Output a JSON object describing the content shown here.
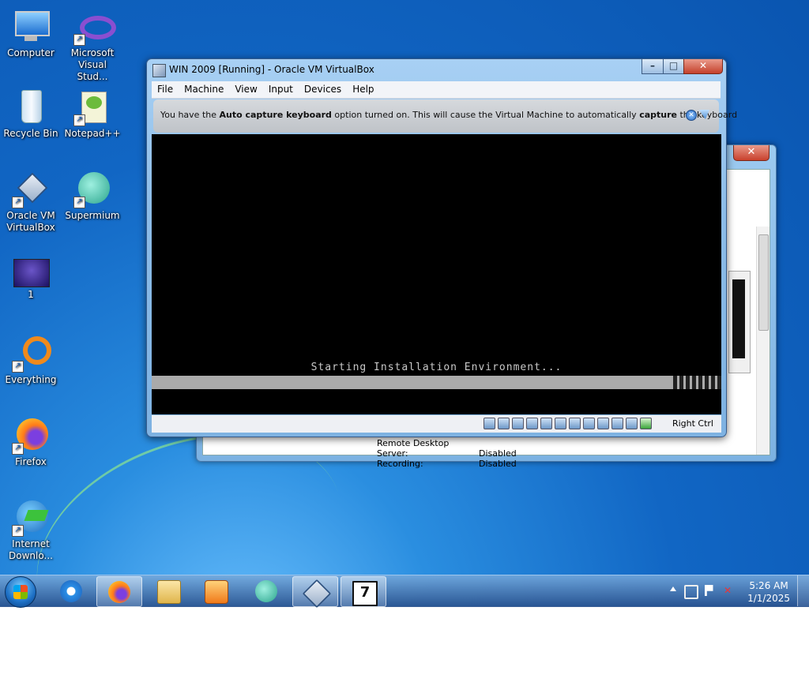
{
  "desktop": {
    "icons": [
      {
        "label": "Computer",
        "icon": "computer-icon"
      },
      {
        "label": "Microsoft Visual Stud...",
        "icon": "visual-studio-icon"
      },
      {
        "label": "Recycle Bin",
        "icon": "recycle-bin-icon"
      },
      {
        "label": "Notepad++",
        "icon": "notepad-plus-plus-icon"
      },
      {
        "label": "Oracle VM VirtualBox",
        "icon": "virtualbox-icon"
      },
      {
        "label": "Supermium",
        "icon": "supermium-icon"
      },
      {
        "label": "1",
        "icon": "image-file-icon"
      },
      {
        "label": "Everything",
        "icon": "everything-search-icon"
      },
      {
        "label": "Firefox",
        "icon": "firefox-icon"
      },
      {
        "label": "Internet Downlo...",
        "icon": "internet-download-manager-icon"
      }
    ]
  },
  "vbox_window": {
    "title": "WIN 2009 [Running] - Oracle VM VirtualBox",
    "buttons": {
      "minimize": "–",
      "maximize": "□",
      "close": "✕"
    },
    "menu": [
      "File",
      "Machine",
      "View",
      "Input",
      "Devices",
      "Help"
    ],
    "notice": {
      "pre": "You have the ",
      "bold1": "Auto capture keyboard",
      "mid": " option turned on. This will cause the Virtual Machine to automatically ",
      "bold2": "capture",
      "post": " the keyboard"
    },
    "guest_screen": {
      "message": "Starting Installation Environment..."
    },
    "status": {
      "icons": [
        "hard-disk-icon",
        "optical-disk-icon",
        "audio-icon",
        "network-icon",
        "usb-icon",
        "shared-folders-icon",
        "display-icon",
        "video-capture-icon",
        "virtualization-icon",
        "cpu-icon",
        "mouse-integration-icon",
        "keyboard-capture-icon"
      ],
      "host_key": "Right Ctrl"
    }
  },
  "back_window": {
    "details": [
      {
        "key": "Remote Desktop Server:",
        "value": "Disabled"
      },
      {
        "key": "Recording:",
        "value": "Disabled"
      }
    ]
  },
  "taskbar": {
    "apps": [
      "internet-explorer-icon",
      "firefox-icon",
      "file-explorer-icon",
      "media-player-icon",
      "supermium-icon",
      "virtualbox-icon",
      "seven-zip-icon"
    ],
    "clock": {
      "time": "5:26 AM",
      "date": "1/1/2025"
    }
  }
}
